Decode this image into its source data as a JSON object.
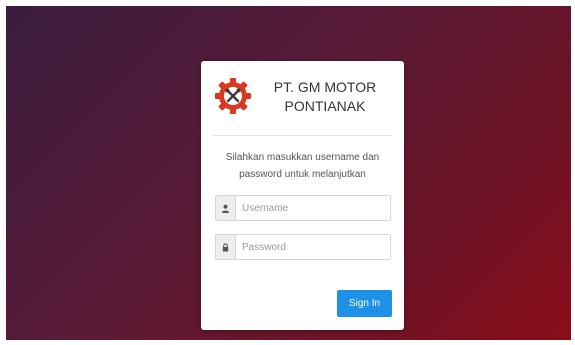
{
  "company": {
    "line1": "PT. GM MOTOR",
    "line2": "PONTIANAK"
  },
  "message": {
    "line1": "Silahkan masukkan username dan",
    "line2": "password untuk melanjutkan"
  },
  "form": {
    "username_placeholder": "Username",
    "password_placeholder": "Password",
    "username_icon": "user-icon",
    "password_icon": "lock-icon",
    "submit_label": "Sign In"
  },
  "colors": {
    "accent": "#1e90e8",
    "logo_gear": "#d73a1e",
    "background_start": "#3a1c3f",
    "background_end": "#8a0d18"
  }
}
